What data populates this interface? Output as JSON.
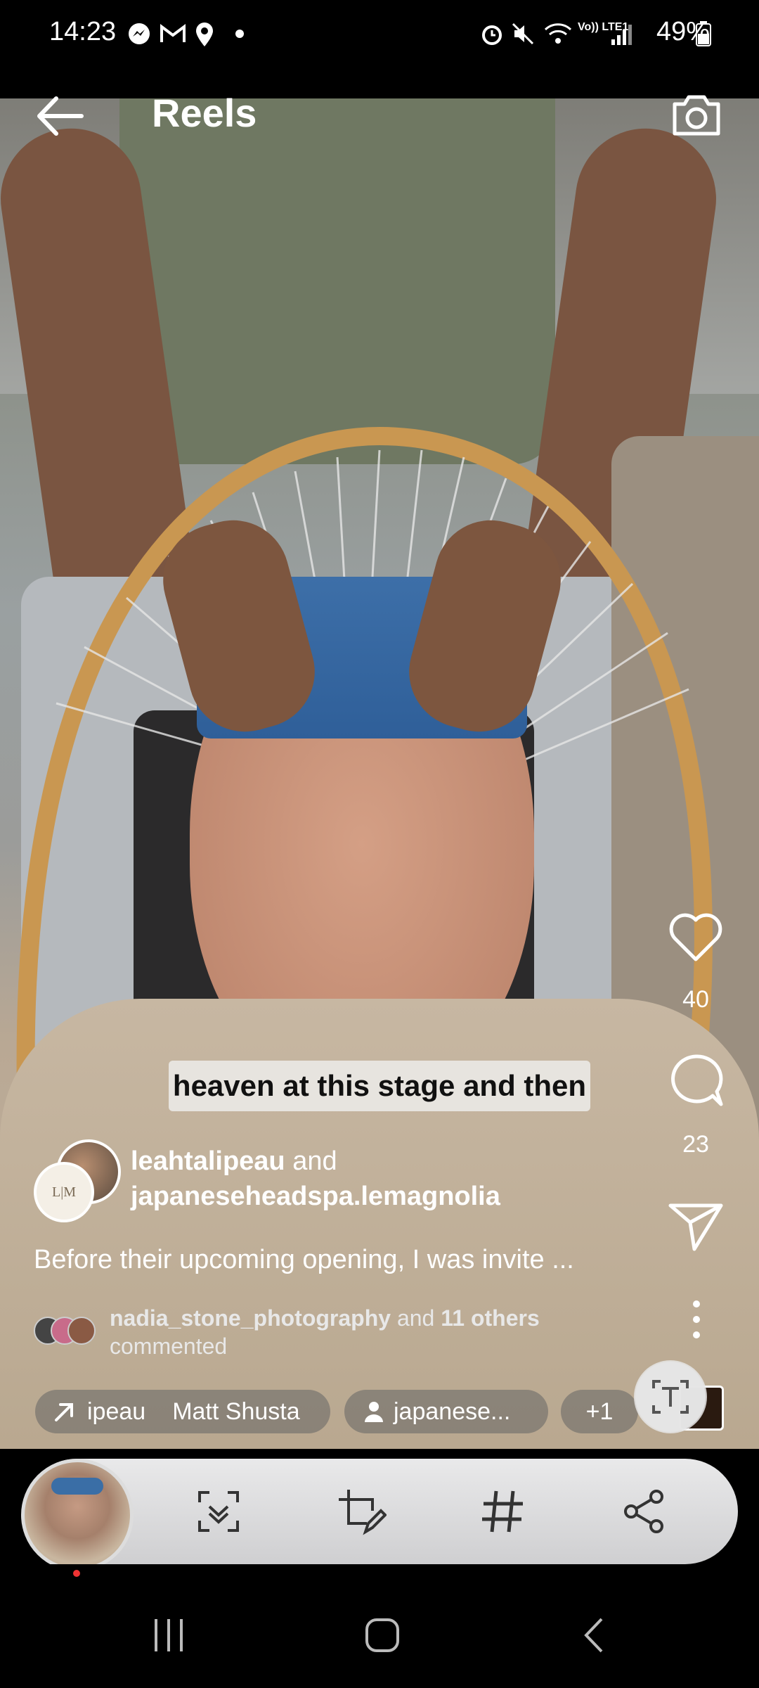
{
  "status_bar": {
    "time": "14:23",
    "battery": "49%",
    "network": "Vo)) LTE1"
  },
  "header": {
    "title": "Reels"
  },
  "overlay_caption": "heaven at this stage and then",
  "actions": {
    "likes": "40",
    "comments": "23"
  },
  "author": {
    "name": "leahtalipeau",
    "connector": "and",
    "collaborator": "japaneseheadspa.lemagnolia",
    "avatar_text": "L|M"
  },
  "description": "Before their upcoming opening, I was invite ...",
  "comments_summary": {
    "first_commenter": "nadia_stone_photography",
    "connector": "and",
    "others": "11 others",
    "suffix": "commented"
  },
  "tags": {
    "collab_prefix": "ipeau",
    "collab_name": "Matt Shusta",
    "tagged": "japanese...",
    "more": "+1"
  },
  "colors": {
    "background": "#000000",
    "toolbar": "#dcdcdd",
    "caption_box": "#e7e4df",
    "recording_dot": "#e33333"
  },
  "icons": [
    "back-arrow-icon",
    "camera-icon",
    "heart-icon",
    "comment-icon",
    "send-icon",
    "more-vertical-icon",
    "text-scan-icon",
    "smart-select-icon",
    "crop-edit-icon",
    "hashtag-icon",
    "share-icon"
  ]
}
